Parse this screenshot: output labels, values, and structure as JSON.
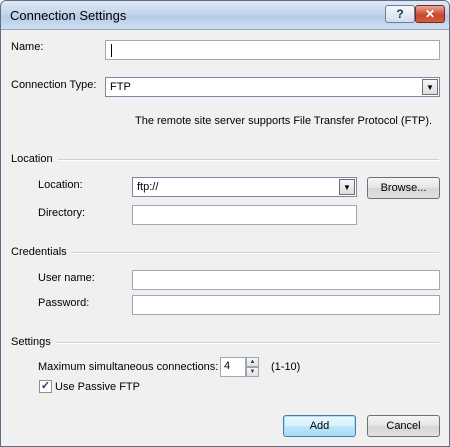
{
  "window": {
    "title": "Connection Settings",
    "help_glyph": "?",
    "close_glyph": "✕"
  },
  "form": {
    "name_label": "Name:",
    "name_value": "",
    "connection_type_label": "Connection Type:",
    "connection_type_value": "FTP",
    "connection_type_description": "The remote site server supports File Transfer Protocol (FTP)."
  },
  "location": {
    "group_title": "Location",
    "location_label": "Location:",
    "location_value": "ftp://",
    "browse_label": "Browse...",
    "directory_label": "Directory:",
    "directory_value": ""
  },
  "credentials": {
    "group_title": "Credentials",
    "username_label": "User name:",
    "username_value": "",
    "password_label": "Password:",
    "password_value": ""
  },
  "settings": {
    "group_title": "Settings",
    "max_connections_label": "Maximum simultaneous connections:",
    "max_connections_value": "4",
    "max_connections_range": "(1-10)",
    "passive_ftp_label": "Use Passive FTP",
    "passive_ftp_checked": true
  },
  "footer": {
    "add_label": "Add",
    "cancel_label": "Cancel"
  },
  "icons": {
    "dropdown_arrow": "▼",
    "spin_up": "▲",
    "spin_down": "▼",
    "check_mark": "✓"
  }
}
